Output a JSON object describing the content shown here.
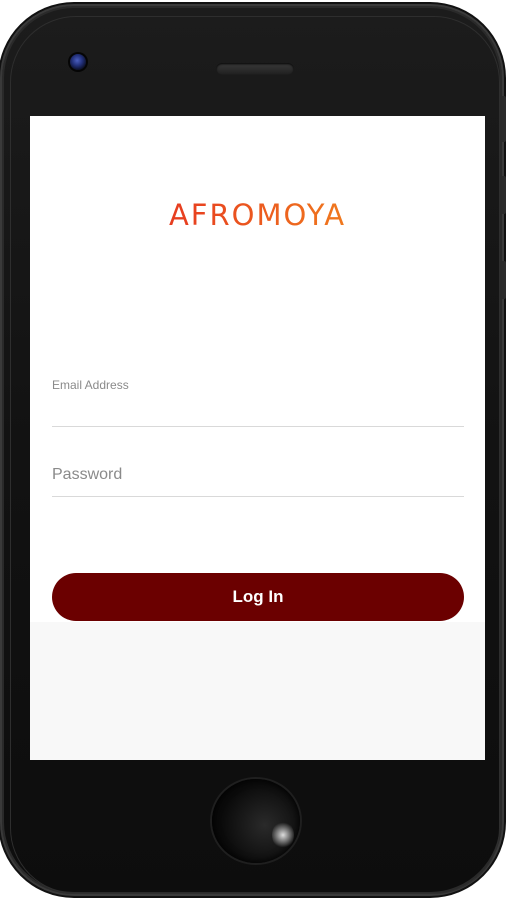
{
  "app": {
    "logo_text": "AFROMOYA",
    "logo_colors": [
      "#d81f26",
      "#f3a51f"
    ]
  },
  "login_form": {
    "email_label": "Email Address",
    "email_value": "",
    "password_placeholder": "Password",
    "password_value": "",
    "login_label": "Log In"
  },
  "colors": {
    "accent": "#6b0000",
    "screen_bg": "#ffffff",
    "device_body": "#141414"
  },
  "icons": {
    "camera": "camera-icon",
    "speaker": "speaker-grille",
    "home": "home-button"
  }
}
